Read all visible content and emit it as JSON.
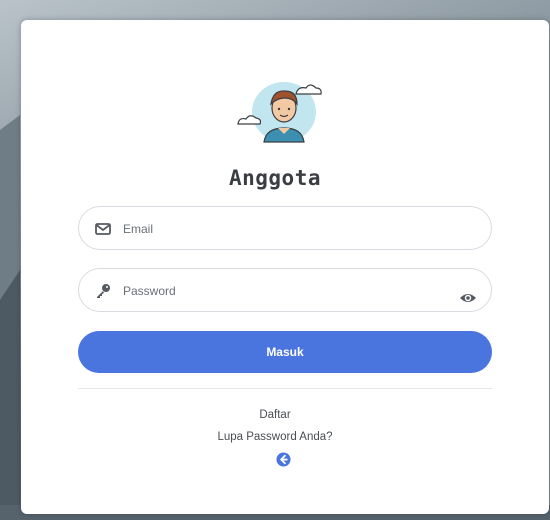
{
  "form": {
    "title": "Anggota",
    "email_placeholder": "Email",
    "password_placeholder": "Password",
    "submit_label": "Masuk"
  },
  "links": {
    "register": "Daftar",
    "forgot_password": "Lupa Password Anda?"
  },
  "colors": {
    "primary": "#4a74de",
    "title": "#3a3d42",
    "avatar_bg": "#bfe4ee"
  },
  "icons": {
    "avatar": "user-avatar-icon",
    "email": "envelope-icon",
    "password": "key-icon",
    "toggle_password": "eye-icon",
    "back": "arrow-left-circle-icon"
  }
}
